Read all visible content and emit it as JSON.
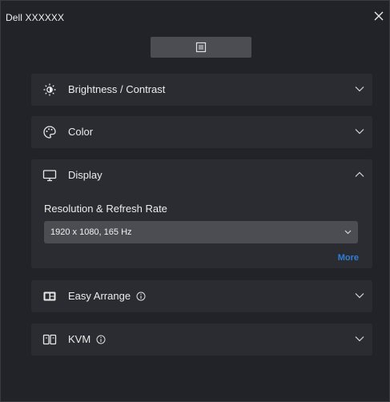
{
  "window": {
    "title": "Dell XXXXXX"
  },
  "sections": [
    {
      "label": "Brightness / Contrast",
      "icon": "brightness-icon",
      "expanded": false
    },
    {
      "label": "Color",
      "icon": "palette-icon",
      "expanded": false
    },
    {
      "label": "Display",
      "icon": "monitor-icon",
      "expanded": true
    },
    {
      "label": "Easy Arrange",
      "icon": "layout-icon",
      "expanded": false,
      "info": true
    },
    {
      "label": "KVM",
      "icon": "kvm-icon",
      "expanded": false,
      "info": true
    }
  ],
  "display": {
    "resolution_label": "Resolution & Refresh Rate",
    "resolution_value": "1920 x 1080, 165 Hz",
    "more_label": "More"
  },
  "colors": {
    "background": "#222328",
    "panel": "#2b2c31",
    "control": "#4c4d52",
    "link": "#2f7ed8"
  }
}
